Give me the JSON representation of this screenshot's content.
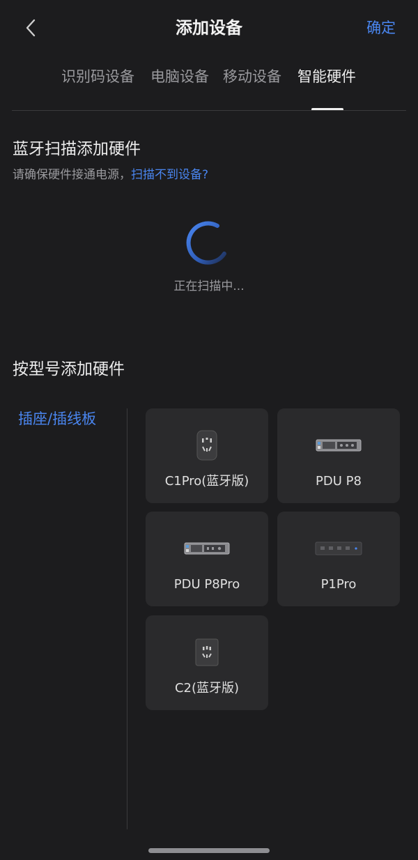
{
  "header": {
    "title": "添加设备",
    "confirm_label": "确定"
  },
  "tabs": [
    {
      "label": "识别码设备",
      "active": false
    },
    {
      "label": "电脑设备",
      "active": false
    },
    {
      "label": "移动设备",
      "active": false
    },
    {
      "label": "智能硬件",
      "active": true
    }
  ],
  "bluetooth": {
    "title": "蓝牙扫描添加硬件",
    "hint": "请确保硬件接通电源，",
    "hint_link": "扫描不到设备?",
    "status": "正在扫描中..."
  },
  "by_model": {
    "title": "按型号添加硬件",
    "categories": [
      {
        "label": "插座/插线板",
        "selected": true
      }
    ],
    "devices": [
      {
        "label": "C1Pro(蓝牙版)",
        "icon": "c1pro-socket-icon"
      },
      {
        "label": "PDU P8",
        "icon": "pdu-p8-icon"
      },
      {
        "label": "PDU P8Pro",
        "icon": "pdu-p8pro-icon"
      },
      {
        "label": "P1Pro",
        "icon": "p1pro-strip-icon"
      },
      {
        "label": "C2(蓝牙版)",
        "icon": "c2-socket-icon"
      }
    ]
  },
  "colors": {
    "background": "#1c1c1e",
    "accent": "#4a86f0",
    "card": "#2a2a2c"
  }
}
